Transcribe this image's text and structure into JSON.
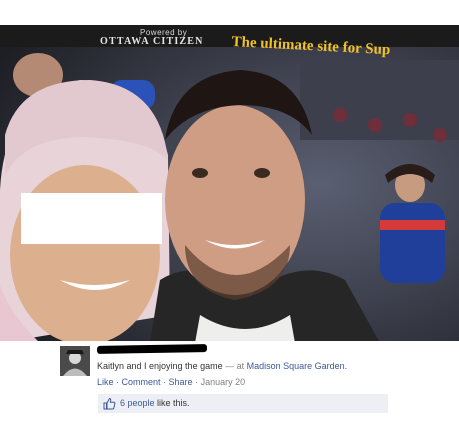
{
  "photo": {
    "banner_powered": "Powered by",
    "banner_brand": "OTTAWA CITIZEN",
    "banner_slogan": "The ultimate site for Sup",
    "colors": {
      "banner": "#1b1b1b",
      "slogan": "#f0c22a",
      "hat": "#e2c9cf"
    }
  },
  "post": {
    "caption_text": "Kaitlyn and I enjoying the game",
    "caption_separator": " — at ",
    "place": "Madison Square Garden.",
    "actions": {
      "like": "Like",
      "comment": "Comment",
      "share": "Share",
      "date": "January 20",
      "dot": " · "
    },
    "likes": {
      "count_text": "6 people",
      "suffix": " like this."
    },
    "colors": {
      "link": "#3b5998",
      "likes_bar": "#edeff4"
    }
  }
}
